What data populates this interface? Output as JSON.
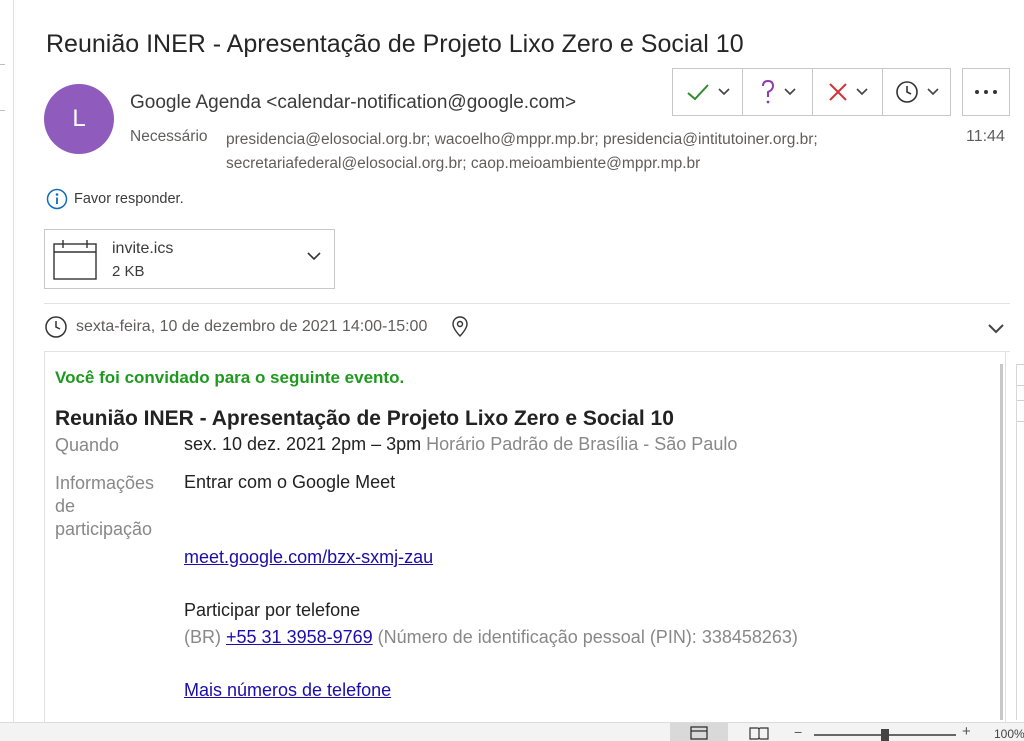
{
  "email": {
    "subject": "Reunião INER - Apresentação de Projeto Lixo Zero e Social 10",
    "avatar_letter": "L",
    "avatar_color": "#8f5cbd",
    "sender": "Google Agenda <calendar-notification@google.com>",
    "required_label": "Necessário",
    "recipients": "presidencia@elosocial.org.br; wacoelho@mppr.mp.br; presidencia@intitutoiner.org.br; secretariafederal@elosocial.org.br; caop.meioambiente@mppr.mp.br",
    "time": "11:44",
    "notice": "Favor responder.",
    "response_buttons": [
      "accept-icon",
      "tentative-icon",
      "decline-icon",
      "propose-time-icon"
    ],
    "more_icon": "more-icon"
  },
  "attachment": {
    "name": "invite.ics",
    "size": "2 KB"
  },
  "event_summary": {
    "datetime": "sexta-feira, 10 de dezembro de 2021 14:00-15:00"
  },
  "invite": {
    "invited_text": "Você foi convidado para o seguinte evento.",
    "invited_color": "#1e9a1e",
    "title": "Reunião INER - Apresentação de Projeto Lixo Zero e Social 10",
    "when_label": "Quando",
    "when_value": "sex. 10 dez. 2021 2pm – 3pm",
    "timezone": "Horário Padrão de Brasília - São Paulo",
    "join_label_1": "Informações",
    "join_label_2": "de",
    "join_label_3": "participação",
    "meet_text": "Entrar com o Google Meet",
    "meet_link": "meet.google.com/bzx-sxmj-zau",
    "phone_heading": "Participar por telefone",
    "phone_country": "(BR)",
    "phone_number": "+55 31 3958-9769",
    "phone_pin": "(Número de identificação pessoal (PIN): 338458263)",
    "more_numbers": "Mais números de telefone"
  },
  "statusbar": {
    "zoom": "100%"
  }
}
